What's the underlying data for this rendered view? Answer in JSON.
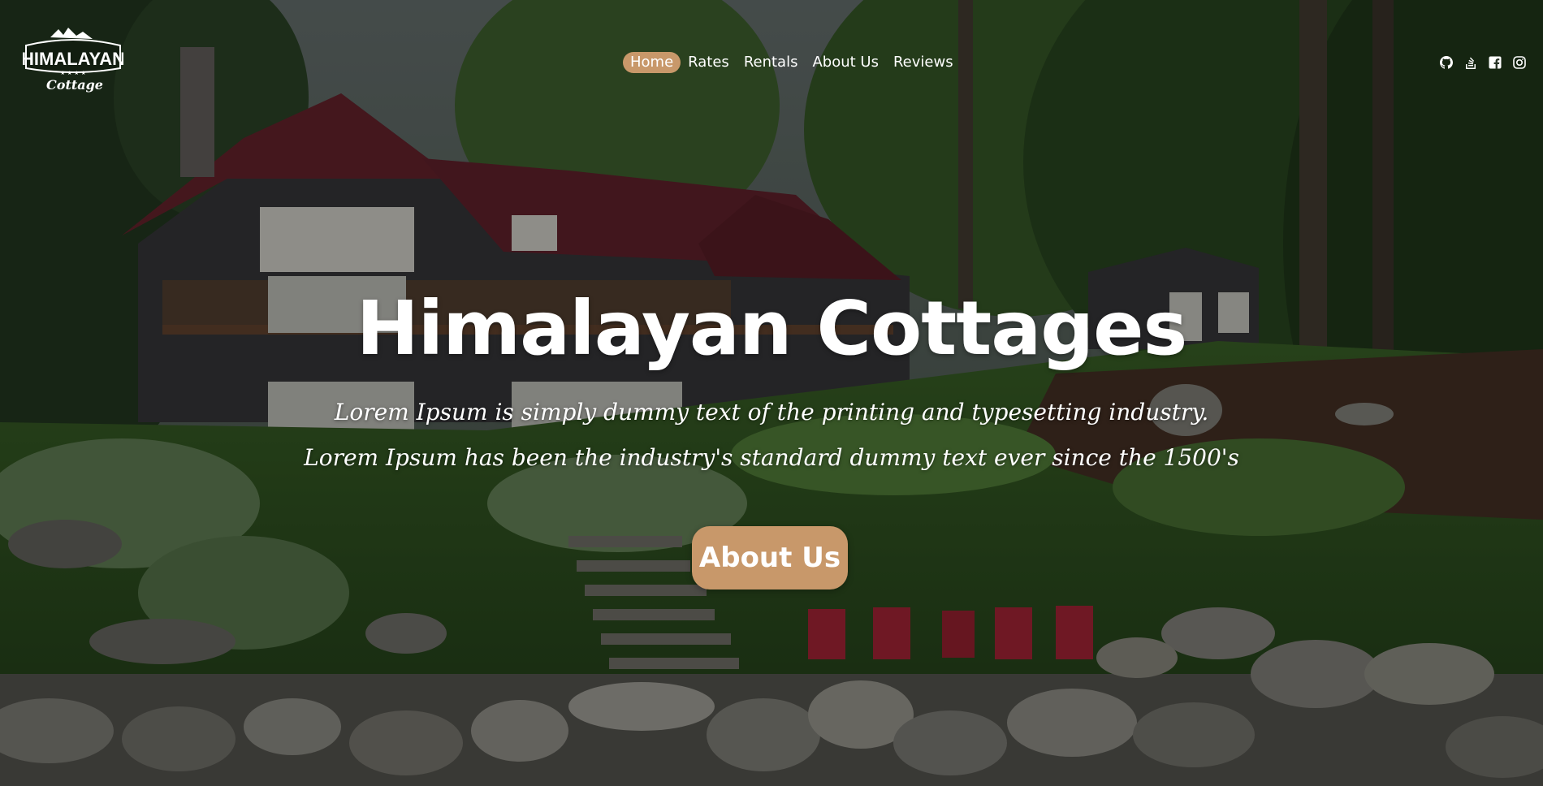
{
  "brand": {
    "logo_top": "HIMALAYAN",
    "logo_bottom": "Cottage"
  },
  "nav": {
    "items": [
      {
        "label": "Home",
        "active": true
      },
      {
        "label": "Rates",
        "active": false
      },
      {
        "label": "Rentals",
        "active": false
      },
      {
        "label": "About Us",
        "active": false
      },
      {
        "label": "Reviews",
        "active": false
      }
    ]
  },
  "social": {
    "icons": [
      "github-icon",
      "stackoverflow-icon",
      "facebook-icon",
      "instagram-icon"
    ]
  },
  "hero": {
    "title": "Himalayan Cottages",
    "tagline_line1": "Lorem Ipsum is simply dummy text of the printing and typesetting industry.",
    "tagline_line2": "Lorem Ipsum has been the industry's standard dummy text ever since the 1500's",
    "cta_label": "About Us"
  },
  "colors": {
    "accent": "#c8986a",
    "text": "#ffffff"
  }
}
